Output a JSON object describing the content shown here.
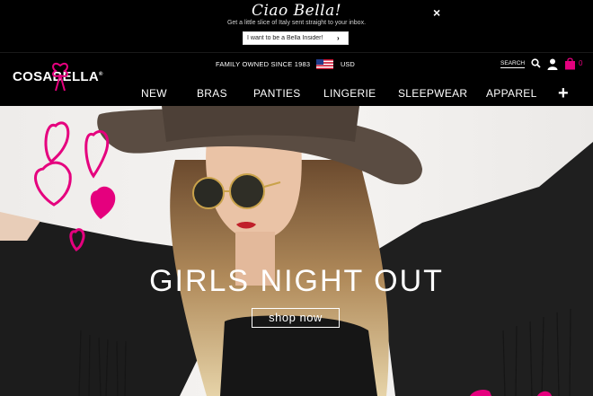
{
  "promo": {
    "headline": "Ciao Bella!",
    "subtext": "Get a little slice of Italy sent straight to your inbox.",
    "signup_placeholder": "I want to be a Bella Insider!",
    "submit_glyph": "›",
    "close_glyph": "×"
  },
  "header": {
    "logo_text": "COSABELLA",
    "logo_mark": "®",
    "tagline": "FAMILY OWNED SINCE 1983",
    "currency": "USD",
    "search_label": "SEARCH",
    "cart_count": "0",
    "nav": [
      "NEW",
      "BRAS",
      "PANTIES",
      "LINGERIE",
      "SLEEPWEAR",
      "APPAREL"
    ],
    "more_glyph": "+"
  },
  "hero": {
    "title": "GIRLS NIGHT OUT",
    "cta": "shop now"
  },
  "colors": {
    "accent_pink": "#e5007e",
    "bar_background": "#000000",
    "text_white": "#ffffff"
  }
}
